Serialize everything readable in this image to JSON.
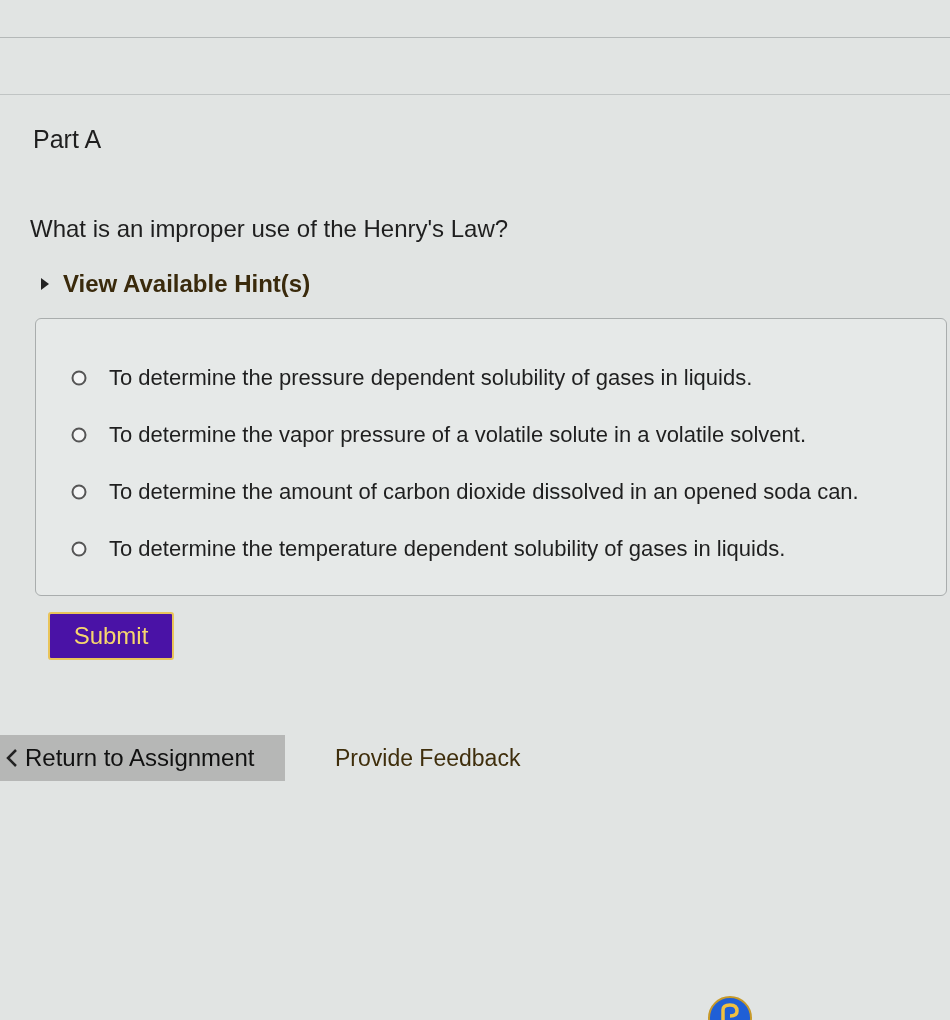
{
  "part": {
    "title": "Part A"
  },
  "question": "What is an improper use of the Henry's Law?",
  "hint_toggle": {
    "label": "View Available Hint(s)",
    "expanded": false
  },
  "options": [
    {
      "label": "To determine the pressure dependent solubility of gases in liquids.",
      "selected": false
    },
    {
      "label": "To determine the vapor pressure of a volatile solute in a volatile solvent.",
      "selected": false
    },
    {
      "label": "To determine the amount of carbon dioxide dissolved in an opened soda can.",
      "selected": false
    },
    {
      "label": "To determine the temperature dependent solubility of gases in liquids.",
      "selected": false
    }
  ],
  "submit_button": {
    "label": "Submit"
  },
  "footer": {
    "return_button": "Return to Assignment",
    "feedback_link": "Provide Feedback"
  }
}
